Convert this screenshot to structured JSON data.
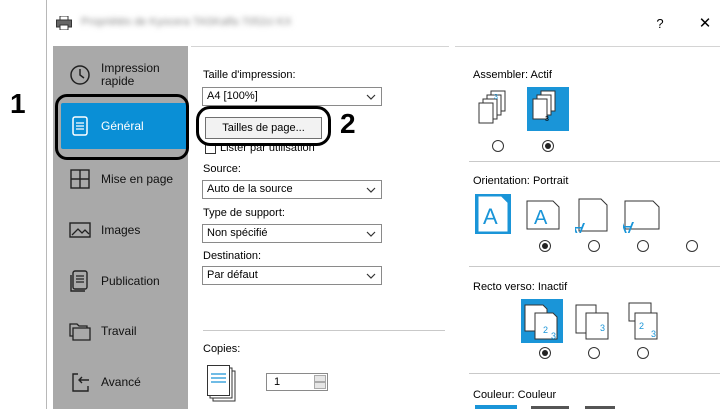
{
  "window": {
    "title": "Propriétés de Kyocera TASKalfa 7052ci KX",
    "help_label": "?",
    "close_label": "✕"
  },
  "sidebar": {
    "items": [
      {
        "label_line1": "Impression",
        "label_line2": "rapide",
        "icon": "clock-icon"
      },
      {
        "label_line1": "Général",
        "label_line2": "",
        "icon": "document-icon",
        "active": true
      },
      {
        "label_line1": "Mise en page",
        "label_line2": "",
        "icon": "layout-grid-icon"
      },
      {
        "label_line1": "Images",
        "label_line2": "",
        "icon": "image-icon"
      },
      {
        "label_line1": "Publication",
        "label_line2": "",
        "icon": "booklet-icon"
      },
      {
        "label_line1": "Travail",
        "label_line2": "",
        "icon": "folders-icon"
      },
      {
        "label_line1": "Avancé",
        "label_line2": "",
        "icon": "arrow-in-icon"
      }
    ]
  },
  "general": {
    "print_size_label": "Taille d'impression:",
    "print_size_value": "A4  [100%]",
    "page_sizes_button": "Tailles de page...",
    "list_by_use_label": "Lister par utilisation",
    "source_label": "Source:",
    "source_value": "Auto de la source",
    "media_type_label": "Type de support:",
    "media_type_value": "Non spécifié",
    "destination_label": "Destination:",
    "destination_value": "Par défaut",
    "copies_label": "Copies:",
    "copies_value": "1"
  },
  "right": {
    "collate_label": "Assembler:",
    "collate_value": "Actif",
    "orientation_label": "Orientation:",
    "orientation_value": "Portrait",
    "duplex_label": "Recto verso:",
    "duplex_value": "Inactif",
    "color_label": "Couleur:",
    "color_value": "Couleur"
  },
  "annotations": {
    "step1": "1",
    "step2": "2"
  },
  "colors": {
    "accent": "#0a8fd6",
    "sidebar_bg": "#a9a9a9",
    "icon_blue": "#1a95d8"
  }
}
